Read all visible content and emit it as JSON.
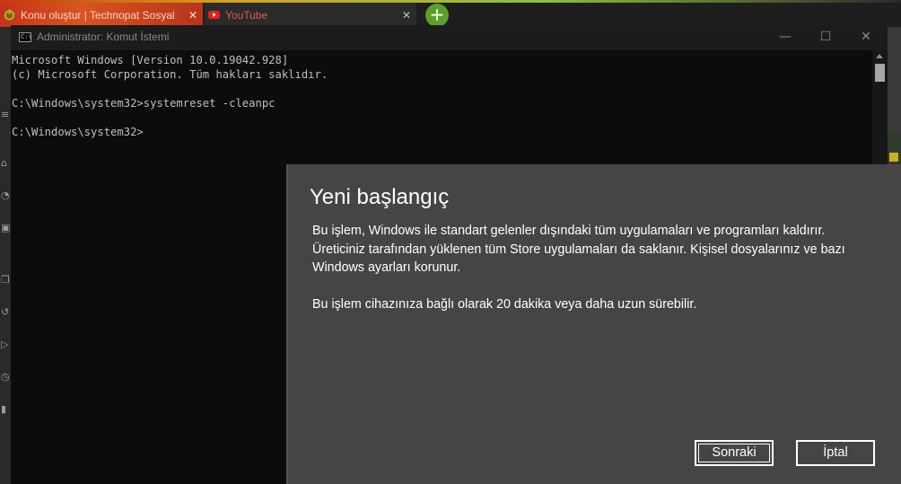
{
  "browser": {
    "tabs": [
      {
        "title": "Konu oluştur | Technopat Sosyal",
        "close": "✕"
      },
      {
        "title": "YouTube",
        "close": "✕"
      }
    ],
    "new_tab": "+"
  },
  "console_window": {
    "title": "Administrator: Komut İstemi",
    "icon_text": "C:\\",
    "controls": {
      "minimize": "—",
      "maximize": "☐",
      "close": "✕"
    },
    "output": "Microsoft Windows [Version 10.0.19042.928]\n(c) Microsoft Corporation. Tüm hakları saklıdır.\n\nC:\\Windows\\system32>systemreset -cleanpc\n\nC:\\Windows\\system32>"
  },
  "dialog": {
    "title": "Yeni başlangıç",
    "body": "Bu işlem, Windows ile standart gelenler dışındaki tüm uygulamaları ve programları kaldırır. Üreticiniz tarafından yüklenen tüm Store uygulamaları da saklanır. Kişisel dosyalarınız ve bazı Windows ayarları korunur.",
    "note": "Bu işlem cihazınıza bağlı olarak 20 dakika veya daha uzun sürebilir.",
    "buttons": {
      "next": "Sonraki",
      "cancel": "İptal"
    }
  },
  "colors": {
    "dialog_bg": "#474543",
    "console_bg": "#0c0c0c",
    "console_text": "#bfbfbf"
  }
}
